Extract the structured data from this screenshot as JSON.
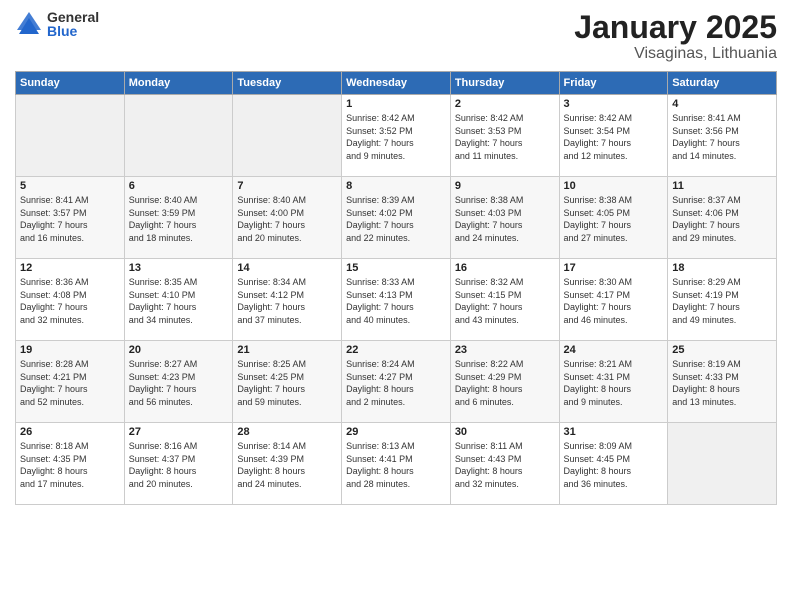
{
  "logo": {
    "general": "General",
    "blue": "Blue"
  },
  "title": {
    "month": "January 2025",
    "location": "Visaginas, Lithuania"
  },
  "headers": [
    "Sunday",
    "Monday",
    "Tuesday",
    "Wednesday",
    "Thursday",
    "Friday",
    "Saturday"
  ],
  "weeks": [
    [
      {
        "day": "",
        "info": ""
      },
      {
        "day": "",
        "info": ""
      },
      {
        "day": "",
        "info": ""
      },
      {
        "day": "1",
        "info": "Sunrise: 8:42 AM\nSunset: 3:52 PM\nDaylight: 7 hours\nand 9 minutes."
      },
      {
        "day": "2",
        "info": "Sunrise: 8:42 AM\nSunset: 3:53 PM\nDaylight: 7 hours\nand 11 minutes."
      },
      {
        "day": "3",
        "info": "Sunrise: 8:42 AM\nSunset: 3:54 PM\nDaylight: 7 hours\nand 12 minutes."
      },
      {
        "day": "4",
        "info": "Sunrise: 8:41 AM\nSunset: 3:56 PM\nDaylight: 7 hours\nand 14 minutes."
      }
    ],
    [
      {
        "day": "5",
        "info": "Sunrise: 8:41 AM\nSunset: 3:57 PM\nDaylight: 7 hours\nand 16 minutes."
      },
      {
        "day": "6",
        "info": "Sunrise: 8:40 AM\nSunset: 3:59 PM\nDaylight: 7 hours\nand 18 minutes."
      },
      {
        "day": "7",
        "info": "Sunrise: 8:40 AM\nSunset: 4:00 PM\nDaylight: 7 hours\nand 20 minutes."
      },
      {
        "day": "8",
        "info": "Sunrise: 8:39 AM\nSunset: 4:02 PM\nDaylight: 7 hours\nand 22 minutes."
      },
      {
        "day": "9",
        "info": "Sunrise: 8:38 AM\nSunset: 4:03 PM\nDaylight: 7 hours\nand 24 minutes."
      },
      {
        "day": "10",
        "info": "Sunrise: 8:38 AM\nSunset: 4:05 PM\nDaylight: 7 hours\nand 27 minutes."
      },
      {
        "day": "11",
        "info": "Sunrise: 8:37 AM\nSunset: 4:06 PM\nDaylight: 7 hours\nand 29 minutes."
      }
    ],
    [
      {
        "day": "12",
        "info": "Sunrise: 8:36 AM\nSunset: 4:08 PM\nDaylight: 7 hours\nand 32 minutes."
      },
      {
        "day": "13",
        "info": "Sunrise: 8:35 AM\nSunset: 4:10 PM\nDaylight: 7 hours\nand 34 minutes."
      },
      {
        "day": "14",
        "info": "Sunrise: 8:34 AM\nSunset: 4:12 PM\nDaylight: 7 hours\nand 37 minutes."
      },
      {
        "day": "15",
        "info": "Sunrise: 8:33 AM\nSunset: 4:13 PM\nDaylight: 7 hours\nand 40 minutes."
      },
      {
        "day": "16",
        "info": "Sunrise: 8:32 AM\nSunset: 4:15 PM\nDaylight: 7 hours\nand 43 minutes."
      },
      {
        "day": "17",
        "info": "Sunrise: 8:30 AM\nSunset: 4:17 PM\nDaylight: 7 hours\nand 46 minutes."
      },
      {
        "day": "18",
        "info": "Sunrise: 8:29 AM\nSunset: 4:19 PM\nDaylight: 7 hours\nand 49 minutes."
      }
    ],
    [
      {
        "day": "19",
        "info": "Sunrise: 8:28 AM\nSunset: 4:21 PM\nDaylight: 7 hours\nand 52 minutes."
      },
      {
        "day": "20",
        "info": "Sunrise: 8:27 AM\nSunset: 4:23 PM\nDaylight: 7 hours\nand 56 minutes."
      },
      {
        "day": "21",
        "info": "Sunrise: 8:25 AM\nSunset: 4:25 PM\nDaylight: 7 hours\nand 59 minutes."
      },
      {
        "day": "22",
        "info": "Sunrise: 8:24 AM\nSunset: 4:27 PM\nDaylight: 8 hours\nand 2 minutes."
      },
      {
        "day": "23",
        "info": "Sunrise: 8:22 AM\nSunset: 4:29 PM\nDaylight: 8 hours\nand 6 minutes."
      },
      {
        "day": "24",
        "info": "Sunrise: 8:21 AM\nSunset: 4:31 PM\nDaylight: 8 hours\nand 9 minutes."
      },
      {
        "day": "25",
        "info": "Sunrise: 8:19 AM\nSunset: 4:33 PM\nDaylight: 8 hours\nand 13 minutes."
      }
    ],
    [
      {
        "day": "26",
        "info": "Sunrise: 8:18 AM\nSunset: 4:35 PM\nDaylight: 8 hours\nand 17 minutes."
      },
      {
        "day": "27",
        "info": "Sunrise: 8:16 AM\nSunset: 4:37 PM\nDaylight: 8 hours\nand 20 minutes."
      },
      {
        "day": "28",
        "info": "Sunrise: 8:14 AM\nSunset: 4:39 PM\nDaylight: 8 hours\nand 24 minutes."
      },
      {
        "day": "29",
        "info": "Sunrise: 8:13 AM\nSunset: 4:41 PM\nDaylight: 8 hours\nand 28 minutes."
      },
      {
        "day": "30",
        "info": "Sunrise: 8:11 AM\nSunset: 4:43 PM\nDaylight: 8 hours\nand 32 minutes."
      },
      {
        "day": "31",
        "info": "Sunrise: 8:09 AM\nSunset: 4:45 PM\nDaylight: 8 hours\nand 36 minutes."
      },
      {
        "day": "",
        "info": ""
      }
    ]
  ]
}
